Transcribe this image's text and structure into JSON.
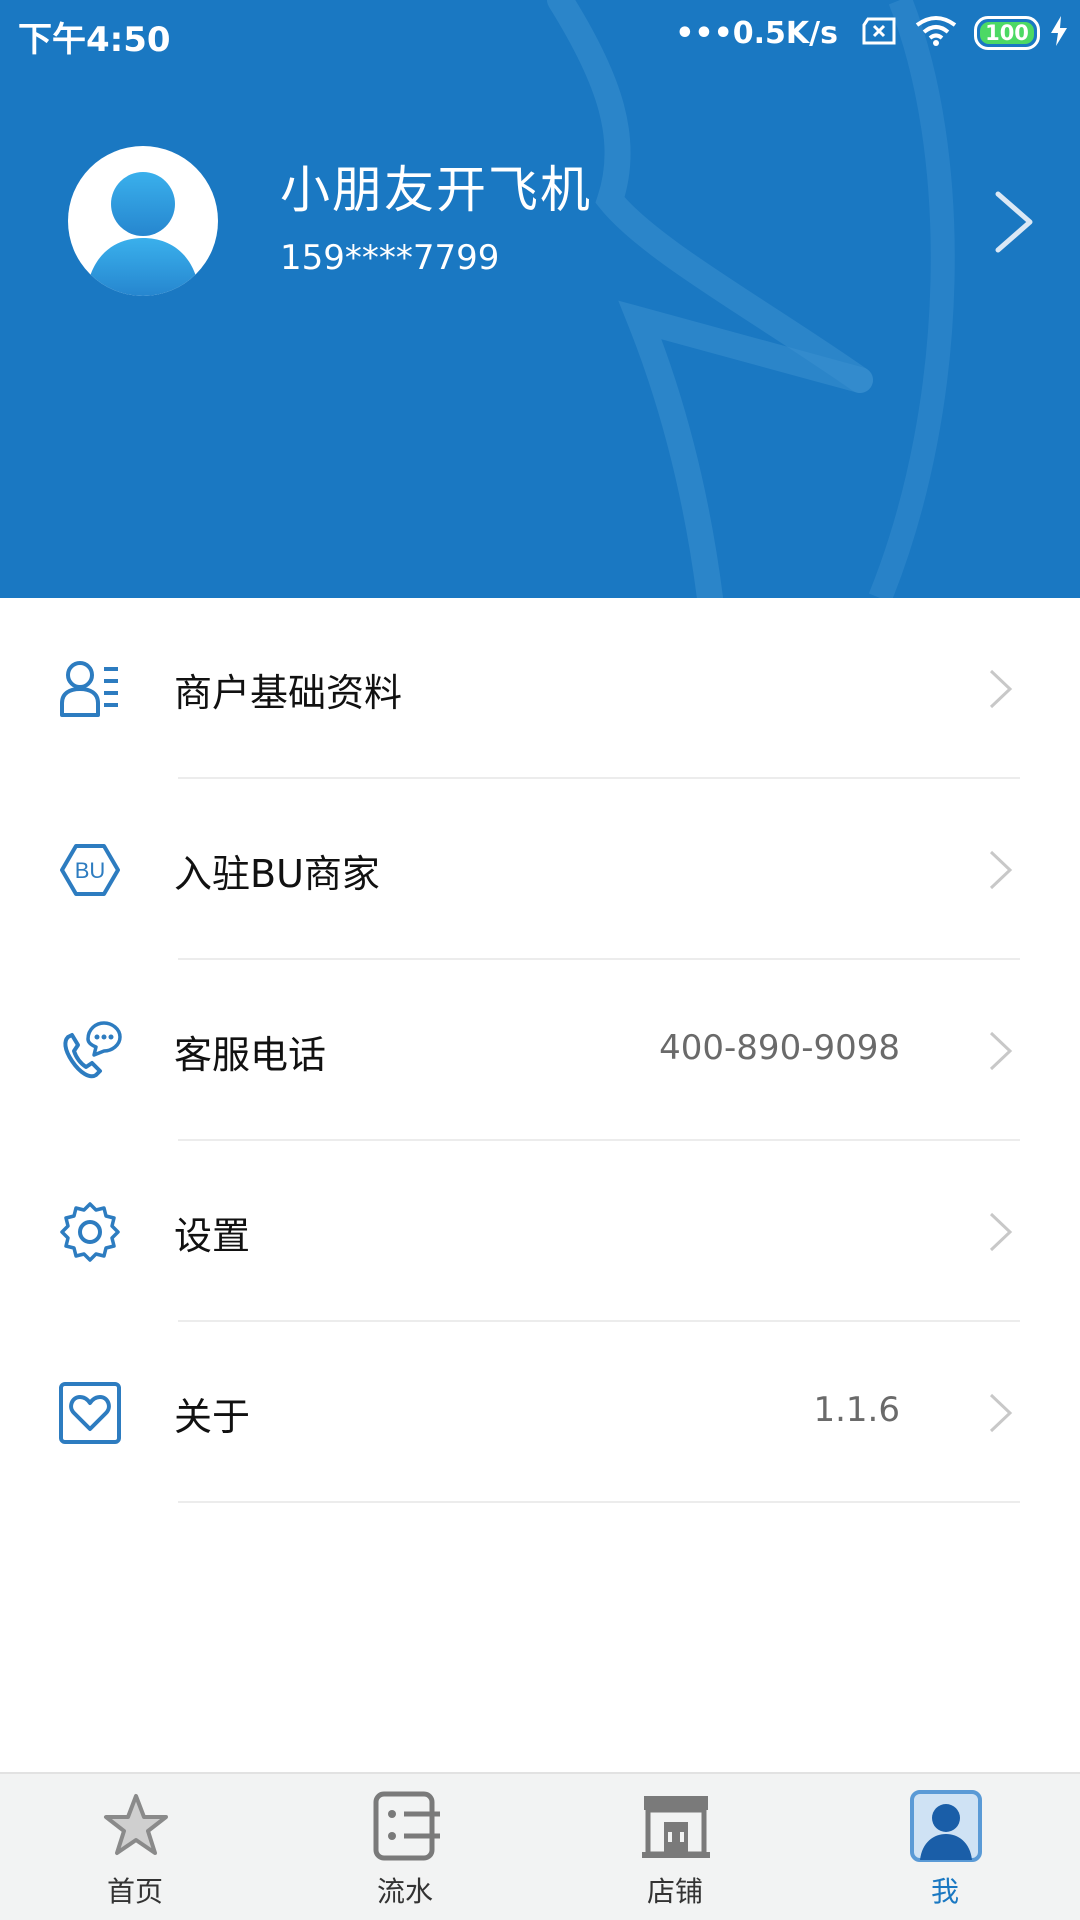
{
  "status_bar": {
    "time": "下午4:50",
    "network_speed": "0.5K/s",
    "battery_level": "100"
  },
  "profile": {
    "name": "小朋友开飞机",
    "phone": "159****7799"
  },
  "menu": {
    "items": [
      {
        "label": "商户基础资料",
        "value": "",
        "icon": "merchant-profile-icon"
      },
      {
        "label": "入驻BU商家",
        "value": "",
        "icon": "bu-hexagon-icon"
      },
      {
        "label": "客服电话",
        "value": "400-890-9098",
        "icon": "phone-chat-icon"
      },
      {
        "label": "设置",
        "value": "",
        "icon": "gear-icon"
      },
      {
        "label": "关于",
        "value": "1.1.6",
        "icon": "heart-box-icon"
      }
    ]
  },
  "tabbar": {
    "tabs": [
      {
        "label": "首页",
        "icon": "star-icon",
        "active": false
      },
      {
        "label": "流水",
        "icon": "ledger-icon",
        "active": false
      },
      {
        "label": "店铺",
        "icon": "store-icon",
        "active": false
      },
      {
        "label": "我",
        "icon": "user-icon",
        "active": true
      }
    ]
  },
  "colors": {
    "primary": "#1a78c2",
    "icon_blue": "#2d7cc0",
    "divider": "#ececec",
    "tab_bg": "#f2f3f3"
  }
}
